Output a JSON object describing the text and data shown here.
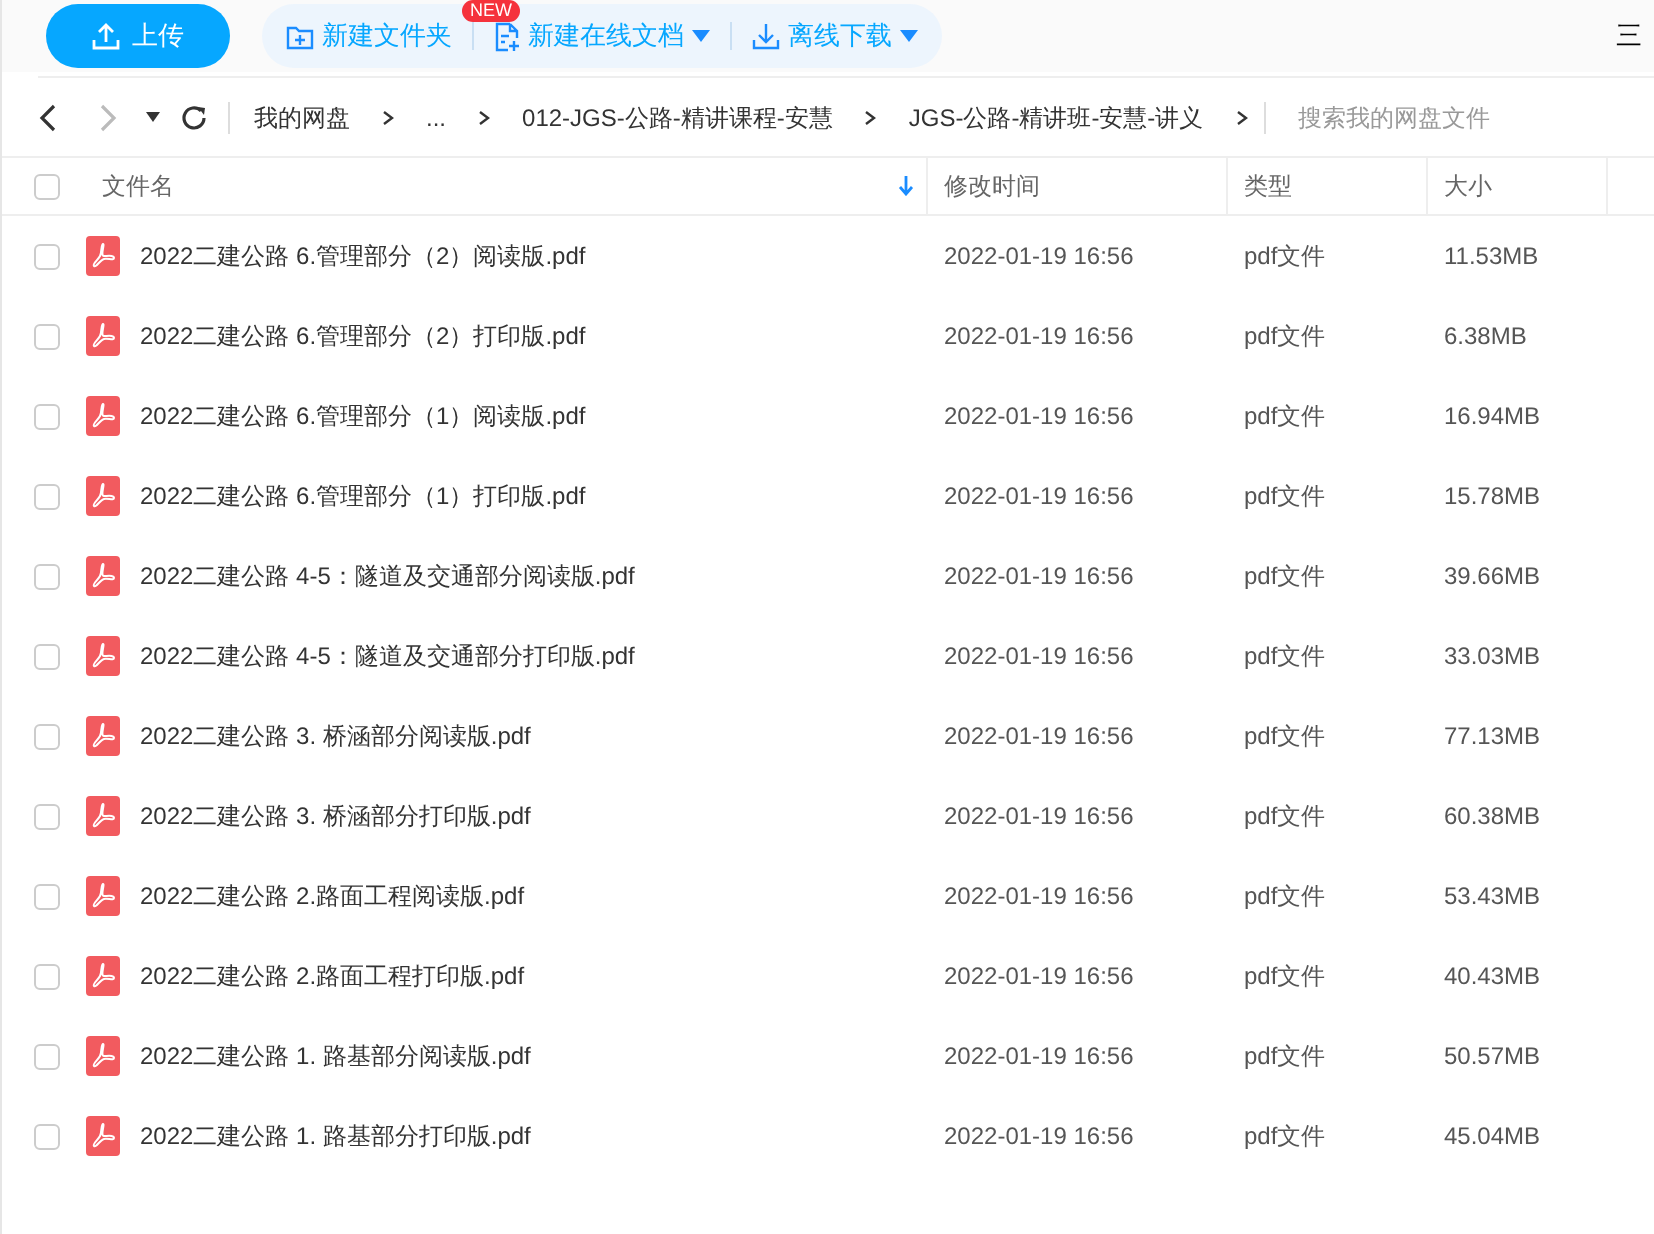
{
  "toolbar": {
    "upload": "上传",
    "actions": [
      {
        "kind": "folder",
        "label": "新建文件夹",
        "dropdown": false
      },
      {
        "kind": "doc",
        "label": "新建在线文档",
        "dropdown": true,
        "badge": "NEW"
      },
      {
        "kind": "download",
        "label": "离线下载",
        "dropdown": true
      }
    ],
    "view_menu": "三"
  },
  "breadcrumb": {
    "path": [
      "我的网盘",
      "...",
      "012-JGS-公路-精讲课程-安慧",
      "JGS-公路-精讲班-安慧-讲义"
    ],
    "search_placeholder": "搜索我的网盘文件"
  },
  "table": {
    "all_selected": false,
    "columns": [
      {
        "label": "文件名",
        "sorted": true
      },
      {
        "label": "修改时间",
        "sorted": false
      },
      {
        "label": "类型",
        "sorted": false
      },
      {
        "label": "大小",
        "sorted": false
      }
    ],
    "rows": [
      {
        "name": "2022二建公路 6.管理部分（2）阅读版.pdf",
        "modified": "2022-01-19 16:56",
        "type": "pdf文件",
        "size": "11.53MB",
        "selected": false
      },
      {
        "name": "2022二建公路 6.管理部分（2）打印版.pdf",
        "modified": "2022-01-19 16:56",
        "type": "pdf文件",
        "size": "6.38MB",
        "selected": false
      },
      {
        "name": "2022二建公路 6.管理部分（1）阅读版.pdf",
        "modified": "2022-01-19 16:56",
        "type": "pdf文件",
        "size": "16.94MB",
        "selected": false
      },
      {
        "name": "2022二建公路 6.管理部分（1）打印版.pdf",
        "modified": "2022-01-19 16:56",
        "type": "pdf文件",
        "size": "15.78MB",
        "selected": false
      },
      {
        "name": "2022二建公路 4-5：隧道及交通部分阅读版.pdf",
        "modified": "2022-01-19 16:56",
        "type": "pdf文件",
        "size": "39.66MB",
        "selected": false
      },
      {
        "name": "2022二建公路 4-5：隧道及交通部分打印版.pdf",
        "modified": "2022-01-19 16:56",
        "type": "pdf文件",
        "size": "33.03MB",
        "selected": false
      },
      {
        "name": "2022二建公路 3. 桥涵部分阅读版.pdf",
        "modified": "2022-01-19 16:56",
        "type": "pdf文件",
        "size": "77.13MB",
        "selected": false
      },
      {
        "name": "2022二建公路 3. 桥涵部分打印版.pdf",
        "modified": "2022-01-19 16:56",
        "type": "pdf文件",
        "size": "60.38MB",
        "selected": false
      },
      {
        "name": "2022二建公路 2.路面工程阅读版.pdf",
        "modified": "2022-01-19 16:56",
        "type": "pdf文件",
        "size": "53.43MB",
        "selected": false
      },
      {
        "name": "2022二建公路 2.路面工程打印版.pdf",
        "modified": "2022-01-19 16:56",
        "type": "pdf文件",
        "size": "40.43MB",
        "selected": false
      },
      {
        "name": "2022二建公路 1. 路基部分阅读版.pdf",
        "modified": "2022-01-19 16:56",
        "type": "pdf文件",
        "size": "50.57MB",
        "selected": false
      },
      {
        "name": "2022二建公路 1. 路基部分打印版.pdf",
        "modified": "2022-01-19 16:56",
        "type": "pdf文件",
        "size": "45.04MB",
        "selected": false
      }
    ]
  }
}
